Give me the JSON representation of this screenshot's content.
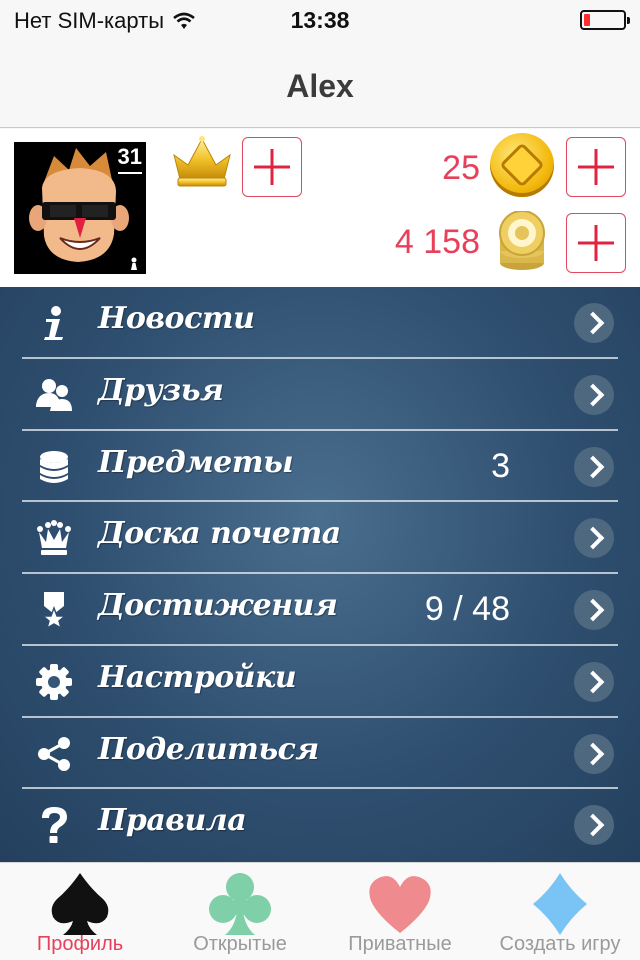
{
  "status_bar": {
    "carrier": "Нет SIM-карты",
    "time": "13:38",
    "battery_level": 0.15
  },
  "nav": {
    "title": "Alex"
  },
  "profile": {
    "level": "31",
    "crown_icon": "crown-icon",
    "coins": "25",
    "chips": "4 158"
  },
  "menu": {
    "items": [
      {
        "label": "Новости",
        "icon": "info-icon",
        "value": ""
      },
      {
        "label": "Друзья",
        "icon": "friends-icon",
        "value": ""
      },
      {
        "label": "Предметы",
        "icon": "coins-stack-icon",
        "value": "3"
      },
      {
        "label": "Доска почета",
        "icon": "queen-icon",
        "value": ""
      },
      {
        "label": "Достижения",
        "icon": "ribbon-star-icon",
        "value": "9 / 48"
      },
      {
        "label": "Настройки",
        "icon": "gear-icon",
        "value": ""
      },
      {
        "label": "Поделиться",
        "icon": "share-icon",
        "value": ""
      },
      {
        "label": "Правила",
        "icon": "question-icon",
        "value": ""
      }
    ]
  },
  "tabs": [
    {
      "label": "Профиль",
      "icon": "spade-icon",
      "color": "#111111",
      "active": true
    },
    {
      "label": "Открытые",
      "icon": "club-icon",
      "color": "#7fd0a8",
      "active": false
    },
    {
      "label": "Приватные",
      "icon": "heart-icon",
      "color": "#ef8a8e",
      "active": false
    },
    {
      "label": "Создать игру",
      "icon": "diamond-icon",
      "color": "#79c3f5",
      "active": false
    }
  ],
  "colors": {
    "accent": "#e8405a",
    "menu_bg": "#2f4f70"
  }
}
